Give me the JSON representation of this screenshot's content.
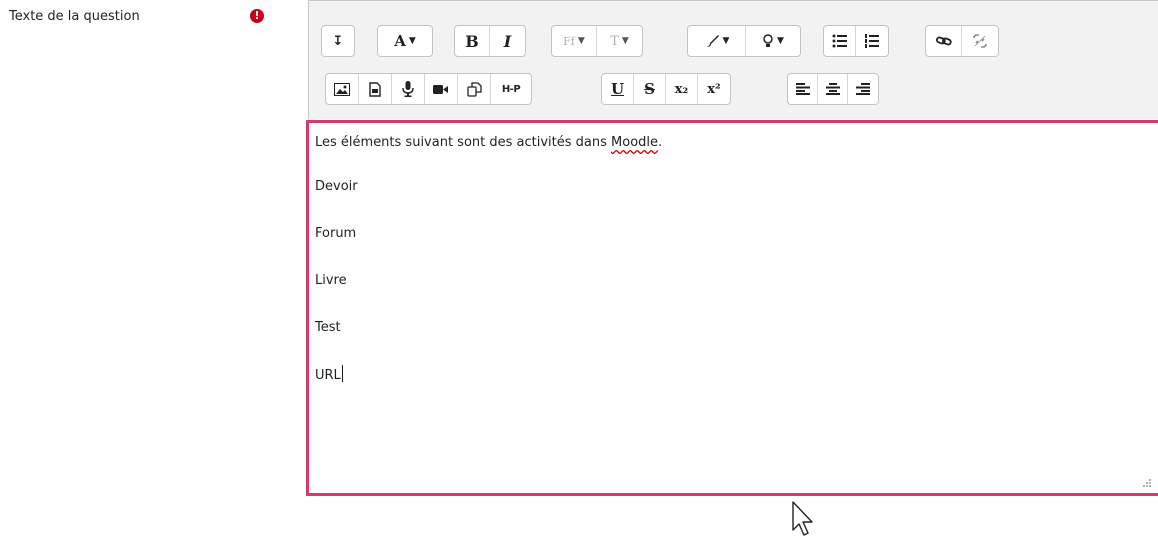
{
  "field": {
    "label": "Texte de la question",
    "required_icon": "!"
  },
  "toolbar": {
    "row1": {
      "expand": "↧",
      "text_style": "A",
      "bold": "B",
      "italic": "I",
      "font_family": "Ff",
      "font_size": "T",
      "color_icon": "paint-brush-icon",
      "highlight_icon": "lightbulb-icon",
      "unordered_list_icon": "unordered-list-icon",
      "ordered_list_icon": "ordered-list-icon",
      "link_icon": "link-icon",
      "unlink_icon": "unlink-icon"
    },
    "row2": {
      "image_icon": "image-icon",
      "media_icon": "media-file-icon",
      "record_audio_icon": "microphone-icon",
      "record_video_icon": "video-camera-icon",
      "manage_files_icon": "copy-files-icon",
      "h5p": "H-P",
      "underline": "U",
      "strikethrough": "S",
      "subscript": "x₂",
      "superscript": "x²",
      "align_left_icon": "align-left-icon",
      "align_center_icon": "align-center-icon",
      "align_right_icon": "align-right-icon"
    }
  },
  "content": {
    "intro_before": "Les éléments suivant sont des activités dans ",
    "intro_misspelled": "Moodle",
    "intro_after": ".",
    "items": [
      "Devoir",
      "Forum",
      "Livre",
      "Test",
      "URL"
    ]
  },
  "colors": {
    "focus_border": "#d33c6a",
    "required": "#c9001b",
    "toolbar_bg": "#f2f2f2"
  }
}
